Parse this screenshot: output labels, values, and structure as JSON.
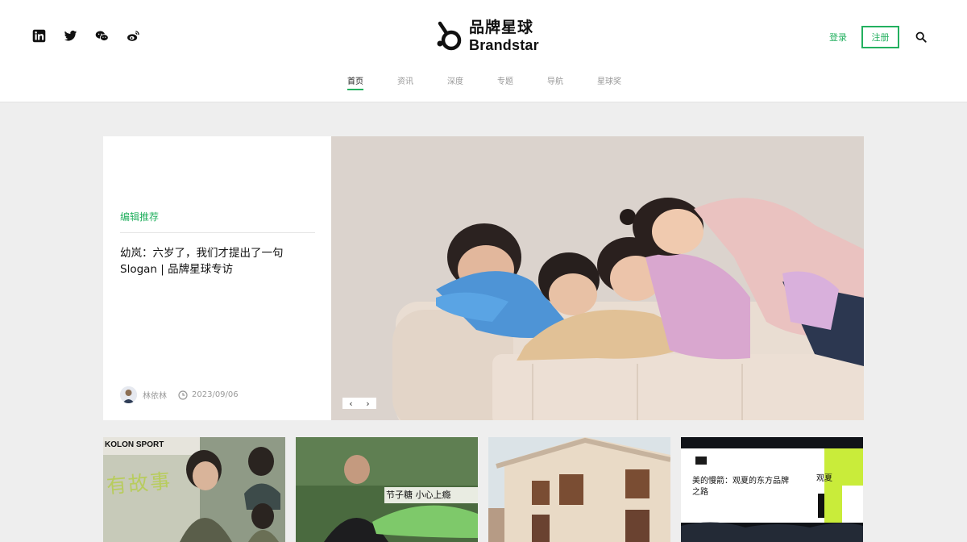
{
  "header": {
    "social_icons": [
      "linkedin-icon",
      "twitter-icon",
      "wechat-icon",
      "weibo-icon"
    ],
    "logo": {
      "cn": "品牌星球",
      "en": "Brandstar"
    },
    "login_label": "登录",
    "register_label": "注册"
  },
  "nav": {
    "items": [
      {
        "label": "首页",
        "active": true
      },
      {
        "label": "资讯",
        "active": false
      },
      {
        "label": "深度",
        "active": false
      },
      {
        "label": "专题",
        "active": false
      },
      {
        "label": "导航",
        "active": false
      },
      {
        "label": "星球奖",
        "active": false
      }
    ]
  },
  "hero": {
    "tag": "编辑推荐",
    "title": "幼岚：六岁了，我们才提出了一句 Slogan | 品牌星球专访",
    "author": "林依林",
    "date": "2023/09/06",
    "prev_label": "‹",
    "next_label": "›"
  },
  "cards": [
    {
      "brand": "KOLON SPORT",
      "overlay": "有故事"
    },
    {
      "overlay": "节子糖 小心上瘾"
    },
    {
      "overlay": ""
    },
    {
      "overlay": "美的慢箭：观夏的东方品牌之路",
      "sub": "观夏"
    }
  ],
  "colors": {
    "accent": "#23b05f",
    "background": "#eeeeee"
  }
}
